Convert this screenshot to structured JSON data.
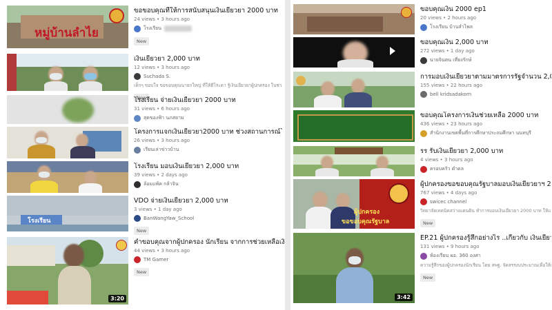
{
  "left": [
    {
      "title": "ขอขอบคุณที่ให้การสนับสนุนเงินเยียวยา 2000 บาท",
      "stats": "24 views • 3 hours ago",
      "channel": "โรงเรียน",
      "thumb_text": "หมู่บ้านลำไย",
      "new": "New"
    },
    {
      "title": "เงินเยียวยา 2,000 บาท",
      "stats": "12 views • 3 hours ago",
      "channel": "Suchada S.",
      "desc": "เด็กๆ ขอบใจ ขอขอบคุณนายกใหญ่ ที่ให้ฮีโระดา รู้เงินเยียวยาผู้ปกครอง ในช่วงโควิด",
      "new": "New"
    },
    {
      "title": "โรงเรียน          จ่ายเงินเยียวยา 2000 บาท",
      "stats": "31 views • 6 hours ago",
      "channel": "สุดของฟ้า นภสยาม"
    },
    {
      "title": "โครงการแจกเงินเยียวยา2000 บาท ช่วงสถานการณ์โรคระบาด",
      "stats": "26 views • 3 hours ago",
      "channel": "เรียนเล่าข่าวบ้าน"
    },
    {
      "title": "โรงเรียน             มอบเงินเยียวยา 2,000 บาท",
      "stats": "39 views • 2 days ago",
      "channel": "ล้อมแพ้ค กล้าจิน"
    },
    {
      "title": "VDO จ่ายเงินเยียวยา 2,000 บาท",
      "stats": "3 views • 1 day ago",
      "channel": "BanWangYaw_School",
      "thumb_text": "โรงเรียน",
      "new": "New"
    },
    {
      "title": "คำขอบคุณจากผู้ปกครอง นักเรียน จากการช่วยเหลือเงินเยียวย",
      "stats": "44 views • 3 hours ago",
      "channel": "TM Gamer",
      "duration": "3:20",
      "new": "New"
    }
  ],
  "right": [
    {
      "title": "ขอบคุณเงิน 2000 ep1",
      "stats": "20 views • 2 hours ago",
      "channel": "โรงเรียน บ้านลำไพล"
    },
    {
      "title": "ขอบคุณเงิน 2,000 บาท",
      "stats": "272 views • 1 day ago",
      "channel": "นายจินตน เที่ยงรักษ์"
    },
    {
      "title": "การมอบเงินเยียวยาตามมาตรการรัฐจำนวน 2,000บาท",
      "stats": "155 views • 22 hours ago",
      "channel": "bell kridsadakorn"
    },
    {
      "title": "ขอบคุณโครงการเงินช่วยเหลือ 2000 บาท",
      "stats": "436 views • 23 hours ago",
      "channel": "สำนักงานเขตพื้นที่การศึกษาประถมศึกษา นนทบุรี"
    },
    {
      "title": "รร           รับเงินเยียวยา 2,000 บาท",
      "stats": "4 views • 3 hours ago",
      "channel": "ครอบครัว ดำดล"
    },
    {
      "title": "ผู้ปกครองขอขอบคุณรัฐบาลมอบเงินเยียวยาฯ 2,000 บ",
      "stats": "767 views • 4 days ago",
      "channel": "swicec channel",
      "desc": "วิทยาลัยเทคนิคสว่างแดนดิน ทำการมอบเงินเยียวยา 2000 บาท ให้แก่ผู้ปกครอง",
      "thumb_text_a": "ผู้ปกครอง",
      "thumb_text_b": "ขอขอบคุณรัฐบาล",
      "new": "New"
    },
    {
      "title": "EP.21 ผู้ปกครองรู้สึกอย่างไร ..เกี่ยวกับ เงินเยียวยา 2",
      "stats": "131 views • 9 hours ago",
      "channel": "ห้องเรียน ผอ. 360 องศา",
      "desc": "ความรู้สึกของผู้ปกครองนักเรียน โดย สพฐ. จัดสรรงบประมาณเพื่อให้ความช่วยเห",
      "duration": "3:42",
      "new": "New"
    }
  ]
}
